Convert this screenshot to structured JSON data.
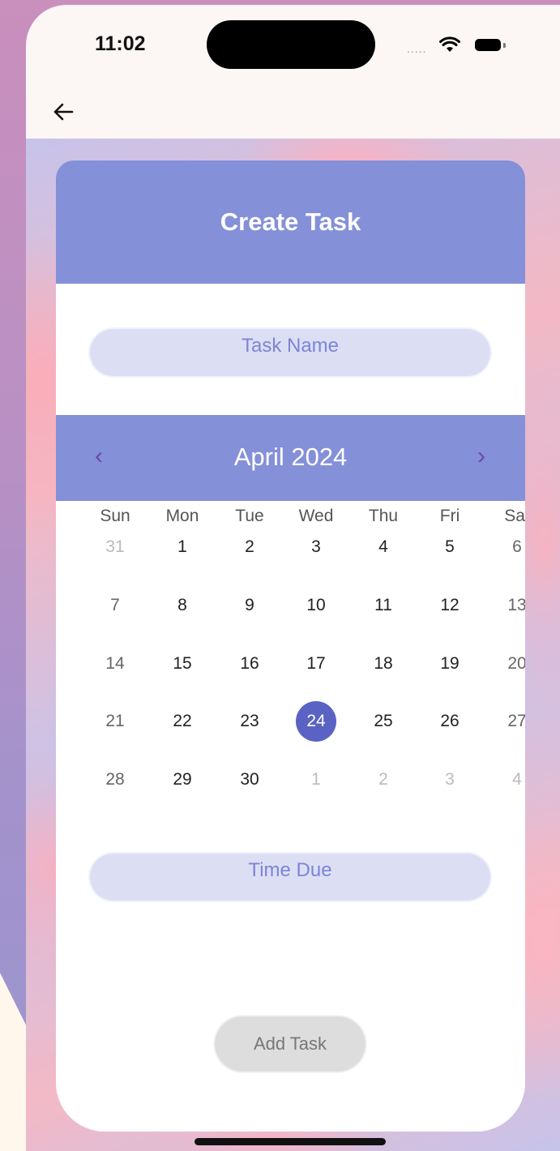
{
  "status_bar": {
    "time": "11:02",
    "signal": "....."
  },
  "card": {
    "title": "Create Task"
  },
  "task_name": {
    "placeholder": "Task Name"
  },
  "calendar": {
    "month_label": "April 2024",
    "weekdays": [
      "Sun",
      "Mon",
      "Tue",
      "Wed",
      "Thu",
      "Fri",
      "Sat"
    ],
    "weeks": [
      [
        "31",
        "1",
        "2",
        "3",
        "4",
        "5",
        "6"
      ],
      [
        "7",
        "8",
        "9",
        "10",
        "11",
        "12",
        "13"
      ],
      [
        "14",
        "15",
        "16",
        "17",
        "18",
        "19",
        "20"
      ],
      [
        "21",
        "22",
        "23",
        "24",
        "25",
        "26",
        "27"
      ],
      [
        "28",
        "29",
        "30",
        "1",
        "2",
        "3",
        "4"
      ]
    ],
    "selected_day": "24"
  },
  "time_due": {
    "placeholder": "Time Due"
  },
  "add_task": {
    "label": "Add Task"
  },
  "colors": {
    "header": "#8490d8",
    "selected_day": "#5a63c3",
    "pill_input": "#dcdff4",
    "nav_chevron": "#6b4aa8"
  },
  "icons": {
    "back": "arrow-left-icon",
    "prev": "chevron-left-icon",
    "next": "chevron-right-icon",
    "wifi": "wifi-icon",
    "battery": "battery-icon"
  }
}
